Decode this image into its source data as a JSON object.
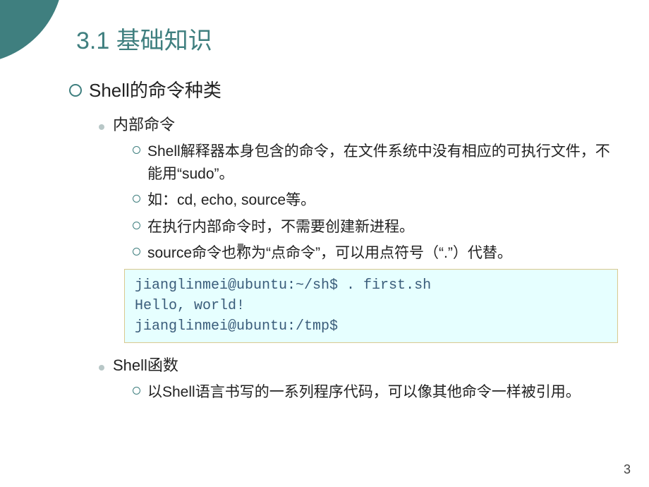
{
  "title": "3.1 基础知识",
  "lvl1": "Shell的命令种类",
  "sec1": {
    "heading": "内部命令",
    "items": [
      "Shell解释器本身包含的命令，在文件系统中没有相应的可执行文件，不能用“sudo”。",
      "如：cd, echo, source等。",
      "在执行内部命令时，不需要创建新进程。",
      "source命令也称为“点命令”，可以用点符号（“.”）代替。"
    ]
  },
  "code": "jianglinmei@ubuntu:~/sh$ . first.sh\nHello, world!\njianglinmei@ubuntu:/tmp$",
  "sec2": {
    "heading": "Shell函数",
    "items": [
      "以Shell语言书写的一系列程序代码，可以像其他命令一样被引用。"
    ]
  },
  "page": "3"
}
